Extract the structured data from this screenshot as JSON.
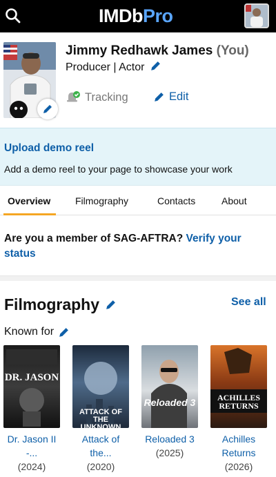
{
  "header": {
    "logo_imdb": "IMDb",
    "logo_pro": "Pro",
    "search_icon": "search-icon",
    "avatar_icon": "user-avatar"
  },
  "profile": {
    "name": "Jimmy Redhawk James",
    "you_tag": "(You)",
    "roles": "Producer | Actor",
    "tracking_label": "Tracking",
    "edit_label": "Edit",
    "icons": {
      "photo_edit": "pencil-icon",
      "roles_edit": "pencil-icon",
      "tracking": "bell-check-icon",
      "edit": "pencil-icon"
    }
  },
  "demo_reel": {
    "link": "Upload demo reel",
    "description": "Add a demo reel to your page to showcase your work"
  },
  "tabs": [
    {
      "label": "Overview",
      "active": true
    },
    {
      "label": "Filmography",
      "active": false
    },
    {
      "label": "Contacts",
      "active": false
    },
    {
      "label": "About",
      "active": false
    }
  ],
  "sag": {
    "question": "Are you a member of SAG-AFTRA?",
    "link": "Verify your status"
  },
  "filmography": {
    "title": "Filmography",
    "see_all": "See all",
    "known_for": "Known for",
    "items": [
      {
        "title": "Dr. Jason II -...",
        "year": "(2024)",
        "poster_text": "DR. JASON"
      },
      {
        "title": "Attack of the...",
        "year": "(2020)",
        "poster_text": "ATTACK OF THE UNKNOWN"
      },
      {
        "title": "Reloaded 3",
        "year": "(2025)",
        "poster_text": "Reloaded 3"
      },
      {
        "title": "Achilles Returns",
        "year": "(2026)",
        "poster_text": "ACHILLES RETURNS"
      }
    ]
  },
  "colors": {
    "link": "#0e5fa8",
    "accent_tab": "#f5a623",
    "banner_bg": "#e4f4f9",
    "topbar_bg": "#000000",
    "pro_blue": "#5aa6ff"
  }
}
